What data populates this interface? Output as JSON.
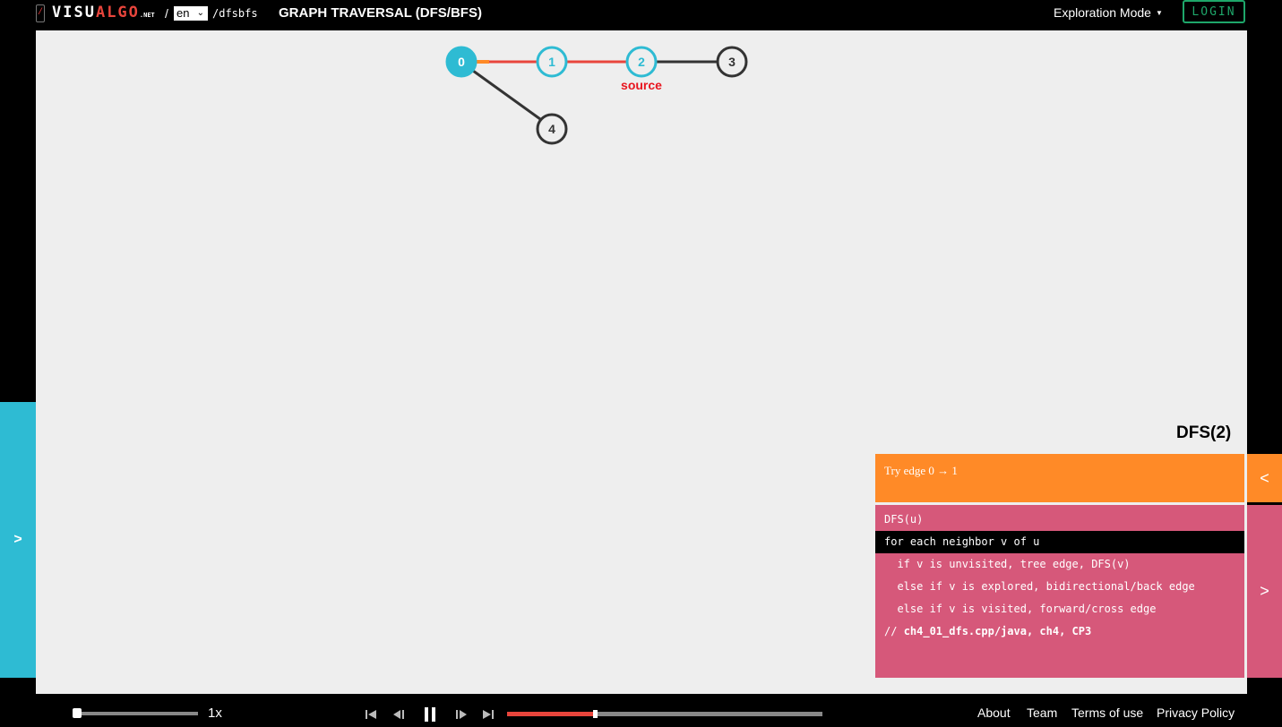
{
  "header": {
    "logo_parts": [
      "VISU",
      "ALGO",
      ".NET"
    ],
    "separator": "/",
    "language": "en",
    "path": "/dfsbfs",
    "title": "GRAPH TRAVERSAL (DFS/BFS)",
    "mode": "Exploration Mode",
    "login": "LOGIN"
  },
  "graph": {
    "nodes": [
      "0",
      "1",
      "2",
      "3",
      "4"
    ],
    "source_label": "source"
  },
  "panel": {
    "status_title": "DFS(2)",
    "status_text": "Try edge 0 → 1",
    "code": [
      "DFS(u)",
      "for each neighbor v of u",
      "  if v is unvisited, tree edge, DFS(v)",
      "  else if v is explored, bidirectional/back edge",
      "  else if v is visited, forward/cross edge",
      "// ",
      "ch4_01_dfs.cpp/java, ch4, CP3"
    ],
    "highlighted_line": 1
  },
  "side": {
    "left_toggle": ">",
    "right_top": "<",
    "right_bottom": ">"
  },
  "playback": {
    "speed": "1x",
    "speed_fraction": 0.03,
    "progress_fraction": 0.28
  },
  "footer": {
    "links": [
      "About",
      "Team",
      "Terms of use",
      "Privacy Policy"
    ]
  },
  "colors": {
    "accent_cyan": "#2ebbd3",
    "orange": "#ff8a27",
    "pink": "#d6587a",
    "red_edge": "#e8453c"
  }
}
